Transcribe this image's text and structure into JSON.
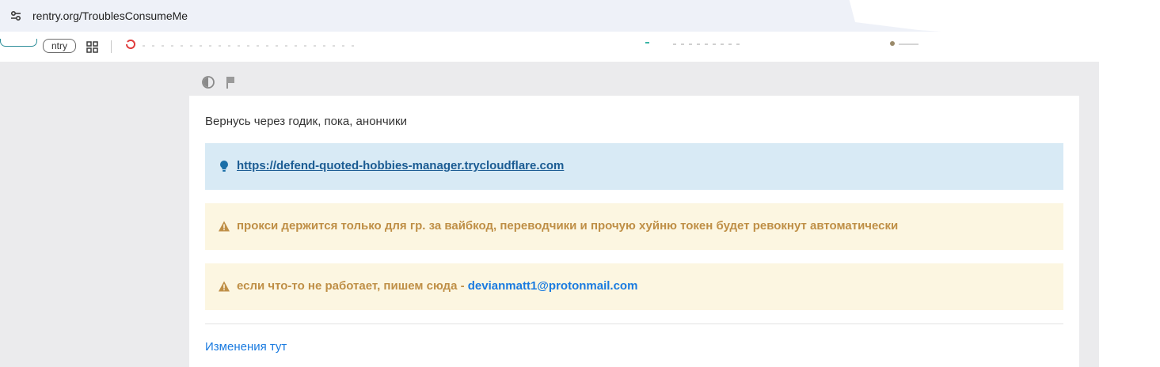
{
  "browser": {
    "url": "rentry.org/TroublesConsumeMe",
    "bookmarks": {
      "chip_2_label": "ntry"
    }
  },
  "page": {
    "intro": "Вернусь через годик, пока, анончики",
    "callouts": {
      "info_link": "https://defend-quoted-hobbies-manager.trycloudflare.com",
      "warn_1": "прокси держится только для гр. за вайбкод, переводчики и прочую хуйню токен будет ревокнут автоматически",
      "warn_2_prefix": "если что-то не работает, пишем сюда - ",
      "warn_2_email": "devianmatt1@protonmail.com"
    },
    "changes_link": "Изменения тут"
  },
  "colors": {
    "info_bg": "#d8eaf5",
    "warn_bg": "#fcf6e1",
    "warn_text": "#bf8f46",
    "link": "#1a7be0"
  },
  "icons": [
    "site-settings-icon",
    "apps-grid-icon",
    "theme-toggle-icon",
    "flag-icon",
    "lightbulb-icon",
    "warning-icon"
  ]
}
